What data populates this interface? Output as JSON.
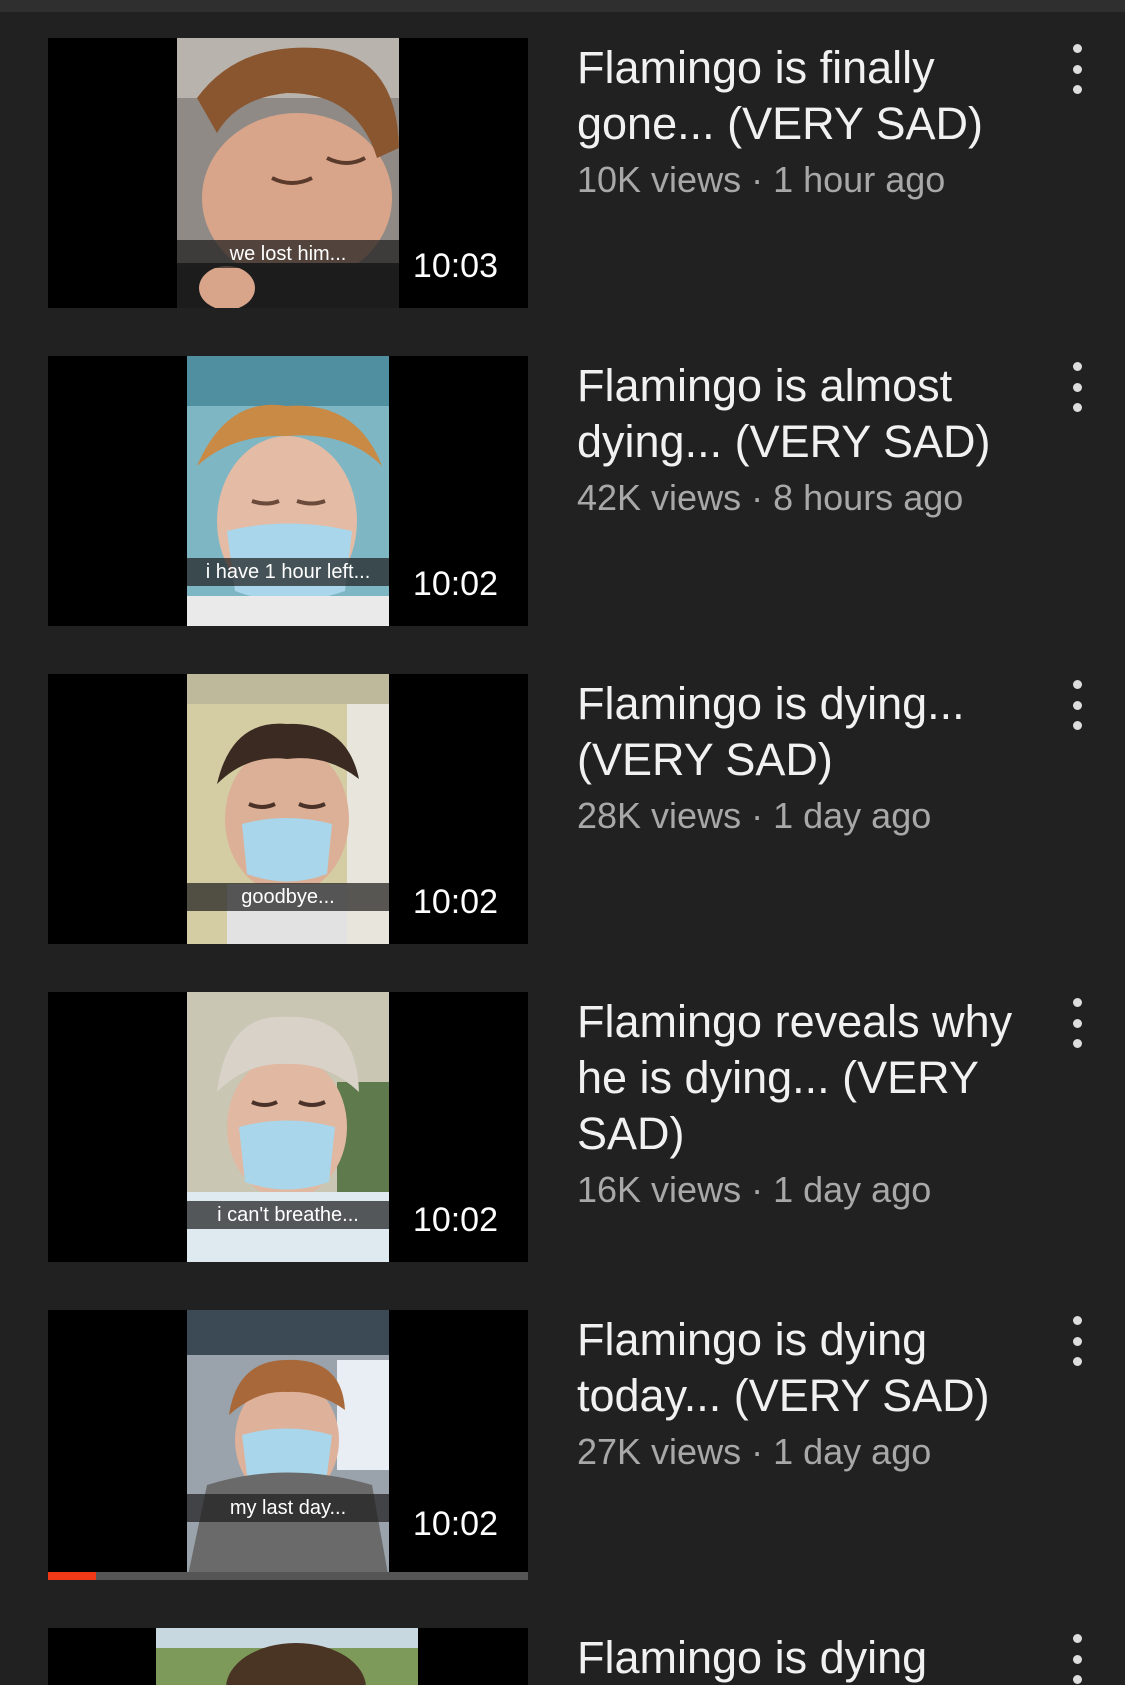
{
  "videos": [
    {
      "title": "Flamingo is finally gone... (VERY SAD)",
      "views": "10K views",
      "age": "1 hour ago",
      "separator": "·",
      "caption": "we lost him...",
      "duration": "10:03"
    },
    {
      "title": "Flamingo is almost dying... (VERY SAD)",
      "views": "42K views",
      "age": "8 hours ago",
      "separator": "·",
      "caption": "i have 1 hour left...",
      "duration": "10:02"
    },
    {
      "title": "Flamingo is dying... (VERY SAD)",
      "views": "28K views",
      "age": "1 day ago",
      "separator": "·",
      "caption": "goodbye...",
      "duration": "10:02"
    },
    {
      "title": "Flamingo reveals why he is dying... (VERY SAD)",
      "views": "16K views",
      "age": "1 day ago",
      "separator": "·",
      "caption": "i can't breathe...",
      "duration": "10:02"
    },
    {
      "title": "Flamingo is dying today... (VERY SAD)",
      "views": "27K views",
      "age": "1 day ago",
      "separator": "·",
      "caption": "my last day...",
      "duration": "10:02",
      "watch_progress": 0.1
    },
    {
      "title": "Flamingo is dying"
    }
  ],
  "theme": {
    "background": "#212121",
    "progress_color": "#f03a17"
  }
}
